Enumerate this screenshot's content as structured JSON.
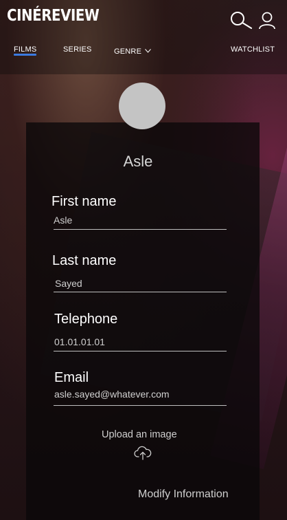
{
  "app": {
    "logo": "CINÉREVIEW"
  },
  "nav": {
    "items": [
      {
        "label": "FILMS",
        "active": true
      },
      {
        "label": "SERIES"
      },
      {
        "label": "GENRE"
      },
      {
        "label": "WATCHLIST"
      }
    ],
    "active_color": "#3b7ae0"
  },
  "header": {
    "search_icon": "search-icon",
    "profile_icon": "user-icon"
  },
  "profile": {
    "display_name": "Asle",
    "avatar_color": "#c4c4c4",
    "fields": {
      "first_name": {
        "label": "First name",
        "value": "Asle"
      },
      "last_name": {
        "label": "Last name",
        "value": "Sayed"
      },
      "telephone": {
        "label": "Telephone",
        "value": "01.01.01.01"
      },
      "email": {
        "label": "Email",
        "value": "asle.sayed@whatever.com"
      }
    },
    "upload_label": "Upload an image",
    "upload_icon": "cloud-upload-icon",
    "modify_label": "Modify Information"
  }
}
